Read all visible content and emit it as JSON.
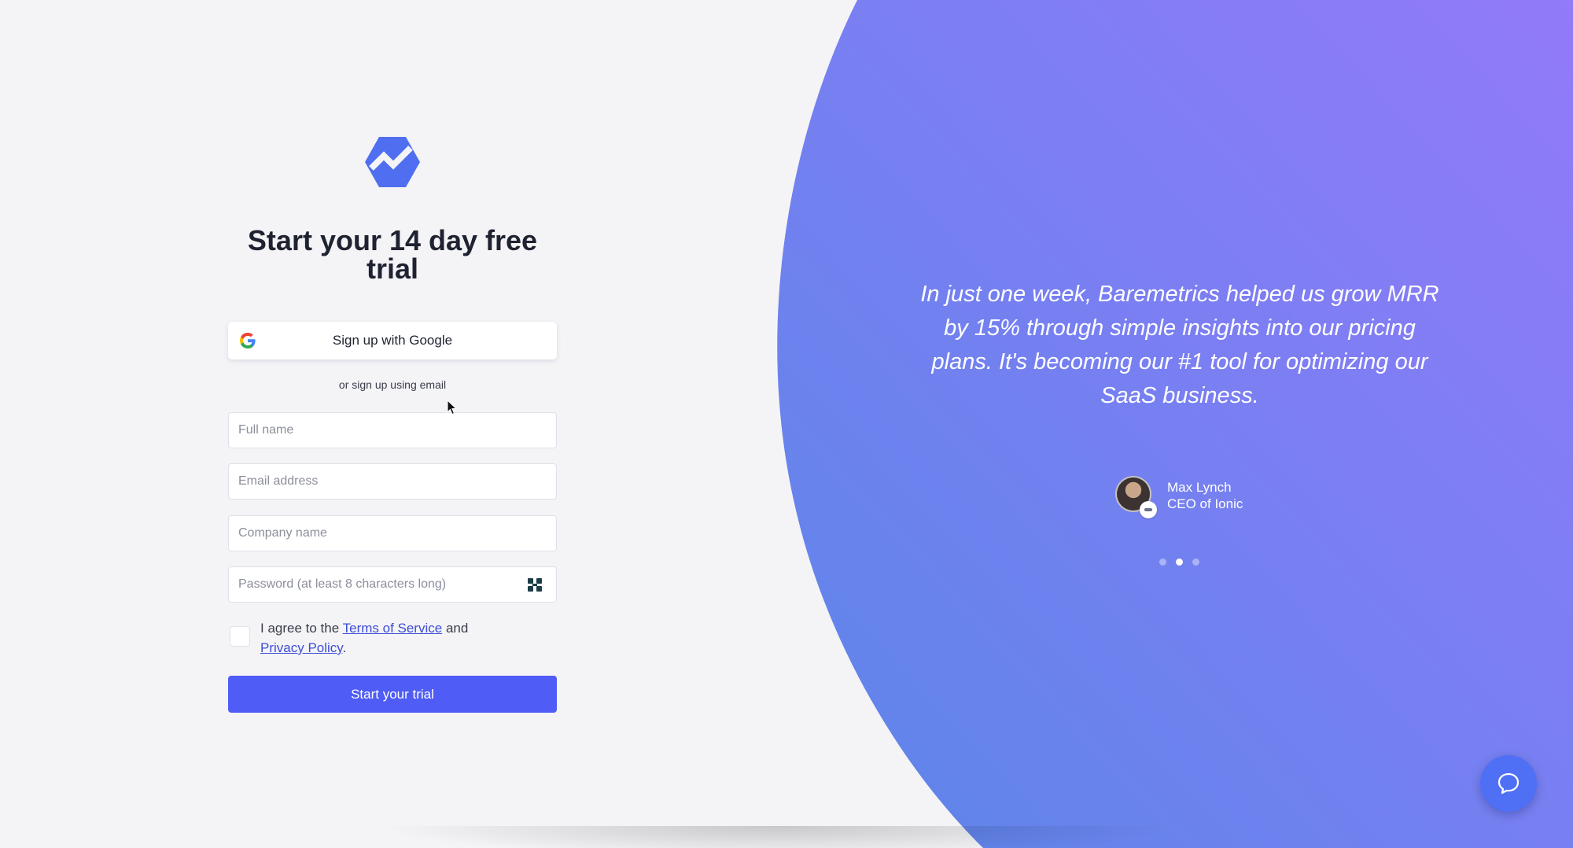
{
  "signup": {
    "title": "Start your 14 day free trial",
    "google_button_label": "Sign up with Google",
    "or_text": "or sign up using email",
    "fields": {
      "full_name_placeholder": "Full name",
      "email_placeholder": "Email address",
      "company_placeholder": "Company name",
      "password_placeholder": "Password (at least 8 characters long)"
    },
    "agree": {
      "prefix": "I agree to the",
      "terms_link": "Terms of Service",
      "middle": "and",
      "privacy_link": "Privacy Policy",
      "suffix": "."
    },
    "submit_label": "Start your trial"
  },
  "testimonial": {
    "quote": "In just one week, Baremetrics helped us grow MRR by 15% through simple insights into our pricing plans. It's becoming our #1 tool for optimizing our SaaS business.",
    "author_name": "Max Lynch",
    "author_role": "CEO of Ionic",
    "active_slide": 2,
    "slide_count": 3
  },
  "icons": {
    "logo": "baremetrics-logo-icon",
    "google": "google-g-icon",
    "password_manager": "password-manager-icon",
    "chat": "chat-bubble-icon",
    "cursor": "mouse-cursor-icon"
  },
  "colors": {
    "brand_blue": "#4f5cf5",
    "gradient_start": "#5b7ee8",
    "gradient_end": "#8f7bf7",
    "background": "#f4f4f7",
    "link": "#3d4dd6"
  }
}
